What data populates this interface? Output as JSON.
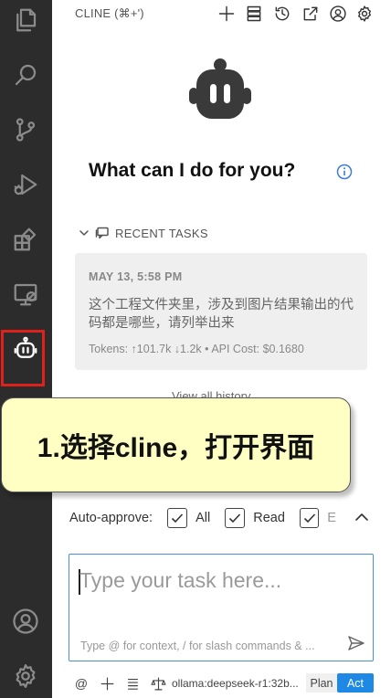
{
  "header": {
    "title": "CLINE (⌘+')",
    "icons": [
      "plus-icon",
      "history-stack-icon",
      "history-icon",
      "popout-icon",
      "account-icon",
      "gear-icon"
    ]
  },
  "activity_bar": {
    "icons": [
      "files-icon",
      "search-icon",
      "source-control-icon",
      "run-debug-icon",
      "extensions-icon",
      "remote-explorer-icon",
      "cline-robot-icon",
      "account-icon",
      "gear-icon"
    ]
  },
  "welcome": {
    "title": "What can I do for you?"
  },
  "recent_tasks": {
    "header": "RECENT TASKS",
    "items": [
      {
        "date": "MAY 13, 5:58 PM",
        "text": "这个工程文件夹里，涉及到图片结果输出的代码都是哪些，请列举出来",
        "meta": "Tokens: ↑101.7k ↓1.2k • API Cost: $0.1680"
      }
    ],
    "view_all": "View all history"
  },
  "annotation": {
    "text": "1.选择cline，打开界面",
    "background": "#ffffc4",
    "highlight_color": "#e0201b"
  },
  "auto_approve": {
    "label": "Auto-approve:",
    "options": [
      {
        "label": "All",
        "checked": true
      },
      {
        "label": "Read",
        "checked": true
      },
      {
        "label": "E",
        "checked": true
      }
    ]
  },
  "input": {
    "placeholder": "Type your task here...",
    "hint": "Type @ for context, / for slash commands & ..."
  },
  "bottom_bar": {
    "at_symbol": "@",
    "model": "ollama:deepseek-r1:32b...",
    "mode_plan": "Plan",
    "mode_act": "Act",
    "accent": "#1e88e5"
  }
}
